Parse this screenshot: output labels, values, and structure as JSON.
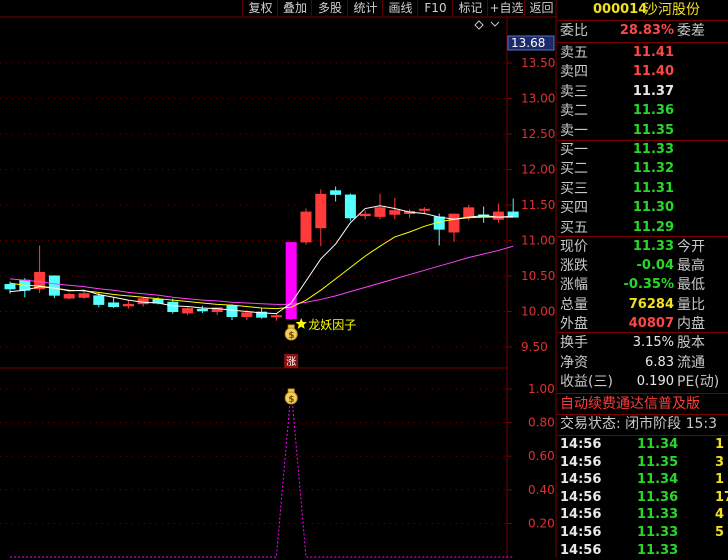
{
  "toolbar": [
    "复权",
    "叠加",
    "多股",
    "统计",
    "画线",
    "F10",
    "标记",
    "+自选",
    "返回"
  ],
  "stock": {
    "code": "000014",
    "name": "沙河股份"
  },
  "price_axis": {
    "current_tag": "13.68",
    "ticks": [
      "13.50",
      "13.00",
      "12.50",
      "12.00",
      "11.50",
      "11.00",
      "10.50",
      "10.00",
      "9.50"
    ]
  },
  "indicator_axis": {
    "ticks": [
      "1.00",
      "0.80",
      "0.60",
      "0.40",
      "0.20"
    ]
  },
  "annotations": {
    "signal": "龙妖因子",
    "limit_up": "涨"
  },
  "icons": {
    "money_bag": "money-bag-icon",
    "star": "star-icon",
    "diamond": "diamond-icon"
  },
  "colors": {
    "up": "#ff3c3c",
    "down": "#54ffff",
    "limit": "#ff00ff",
    "ma5": "#ffffff",
    "ma10": "#ffff00",
    "ma20": "#ff40ff",
    "grid": "#7a0000",
    "signal": "#ffff00"
  },
  "order_book": {
    "weibi": {
      "label": "委比",
      "value": "28.83%",
      "suffix": "委差"
    },
    "sells": [
      {
        "label": "卖五",
        "price": "11.41"
      },
      {
        "label": "卖四",
        "price": "11.40"
      },
      {
        "label": "卖三",
        "price": "11.37"
      },
      {
        "label": "卖二",
        "price": "11.36"
      },
      {
        "label": "卖一",
        "price": "11.35"
      }
    ],
    "buys": [
      {
        "label": "买一",
        "price": "11.33"
      },
      {
        "label": "买二",
        "price": "11.32"
      },
      {
        "label": "买三",
        "price": "11.31"
      },
      {
        "label": "买四",
        "price": "11.30"
      },
      {
        "label": "买五",
        "price": "11.29"
      }
    ]
  },
  "stats": [
    {
      "label": "现价",
      "value": "11.33",
      "label2": "今开"
    },
    {
      "label": "涨跌",
      "value": "-0.04",
      "label2": "最高"
    },
    {
      "label": "涨幅",
      "value": "-0.35%",
      "label2": "最低"
    },
    {
      "label": "总量",
      "value": "76284",
      "label2": "量比"
    },
    {
      "label": "外盘",
      "value": "40807",
      "label2": "内盘"
    }
  ],
  "stats2": [
    {
      "label": "换手",
      "value": "3.15%",
      "label2": "股本"
    },
    {
      "label": "净资",
      "value": "6.83",
      "label2": "流通"
    },
    {
      "label": "收益(三)",
      "value": "0.190",
      "label2": "PE(动)"
    }
  ],
  "promo": "自动续费通达信普及版",
  "trade_state": "交易状态: 闭市阶段 15:3",
  "ticks": [
    {
      "time": "14:56",
      "price": "11.34",
      "vol": "1"
    },
    {
      "time": "14:56",
      "price": "11.35",
      "vol": "3"
    },
    {
      "time": "14:56",
      "price": "11.34",
      "vol": "1"
    },
    {
      "time": "14:56",
      "price": "11.36",
      "vol": "17"
    },
    {
      "time": "14:56",
      "price": "11.33",
      "vol": "4"
    },
    {
      "time": "14:56",
      "price": "11.33",
      "vol": "5"
    },
    {
      "time": "14:56",
      "price": "11.33",
      "vol": ""
    }
  ],
  "chart_data": [
    {
      "type": "candlestick",
      "ylim": [
        9.3,
        13.68
      ],
      "candles": [
        {
          "o": 10.38,
          "h": 10.42,
          "l": 10.25,
          "c": 10.32
        },
        {
          "o": 10.44,
          "h": 10.47,
          "l": 10.2,
          "c": 10.3
        },
        {
          "o": 10.32,
          "h": 10.93,
          "l": 10.26,
          "c": 10.55
        },
        {
          "o": 10.5,
          "h": 10.51,
          "l": 10.19,
          "c": 10.23
        },
        {
          "o": 10.19,
          "h": 10.26,
          "l": 10.17,
          "c": 10.24
        },
        {
          "o": 10.2,
          "h": 10.3,
          "l": 10.18,
          "c": 10.25
        },
        {
          "o": 10.22,
          "h": 10.26,
          "l": 10.06,
          "c": 10.1
        },
        {
          "o": 10.12,
          "h": 10.2,
          "l": 10.05,
          "c": 10.07
        },
        {
          "o": 10.08,
          "h": 10.16,
          "l": 10.04,
          "c": 10.1
        },
        {
          "o": 10.11,
          "h": 10.2,
          "l": 10.07,
          "c": 10.18
        },
        {
          "o": 10.17,
          "h": 10.2,
          "l": 10.1,
          "c": 10.12
        },
        {
          "o": 10.13,
          "h": 10.18,
          "l": 9.97,
          "c": 10.0
        },
        {
          "o": 9.98,
          "h": 10.06,
          "l": 9.95,
          "c": 10.04
        },
        {
          "o": 10.03,
          "h": 10.08,
          "l": 9.98,
          "c": 10.01
        },
        {
          "o": 10.0,
          "h": 10.06,
          "l": 9.95,
          "c": 10.05
        },
        {
          "o": 10.08,
          "h": 10.1,
          "l": 9.88,
          "c": 9.93
        },
        {
          "o": 9.93,
          "h": 10.02,
          "l": 9.88,
          "c": 9.98
        },
        {
          "o": 9.99,
          "h": 10.05,
          "l": 9.9,
          "c": 9.92
        },
        {
          "o": 9.93,
          "h": 9.97,
          "l": 9.87,
          "c": 9.94
        },
        {
          "o": 9.9,
          "h": 10.97,
          "l": 9.88,
          "c": 10.97
        },
        {
          "o": 10.98,
          "h": 11.45,
          "l": 10.94,
          "c": 11.4
        },
        {
          "o": 11.18,
          "h": 11.72,
          "l": 10.92,
          "c": 11.65
        },
        {
          "o": 11.7,
          "h": 11.76,
          "l": 11.55,
          "c": 11.65
        },
        {
          "o": 11.64,
          "h": 11.66,
          "l": 11.28,
          "c": 11.32
        },
        {
          "o": 11.35,
          "h": 11.42,
          "l": 11.3,
          "c": 11.37
        },
        {
          "o": 11.34,
          "h": 11.66,
          "l": 11.3,
          "c": 11.46
        },
        {
          "o": 11.37,
          "h": 11.6,
          "l": 11.3,
          "c": 11.42
        },
        {
          "o": 11.38,
          "h": 11.44,
          "l": 11.32,
          "c": 11.41
        },
        {
          "o": 11.43,
          "h": 11.47,
          "l": 11.37,
          "c": 11.44
        },
        {
          "o": 11.33,
          "h": 11.38,
          "l": 10.93,
          "c": 11.16
        },
        {
          "o": 11.12,
          "h": 11.38,
          "l": 10.98,
          "c": 11.37
        },
        {
          "o": 11.33,
          "h": 11.5,
          "l": 11.28,
          "c": 11.46
        },
        {
          "o": 11.36,
          "h": 11.48,
          "l": 11.25,
          "c": 11.33
        },
        {
          "o": 11.3,
          "h": 11.52,
          "l": 11.25,
          "c": 11.4
        },
        {
          "o": 11.4,
          "h": 11.59,
          "l": 11.33,
          "c": 11.33
        }
      ],
      "ma5": [
        10.28,
        10.3,
        10.35,
        10.33,
        10.29,
        10.3,
        10.24,
        10.2,
        10.16,
        10.13,
        10.12,
        10.08,
        10.07,
        10.05,
        10.04,
        10.02,
        10.0,
        9.98,
        9.97,
        10.12,
        10.43,
        10.74,
        10.95,
        11.25,
        11.45,
        11.49,
        11.45,
        11.4,
        11.38,
        11.33,
        11.3,
        11.33,
        11.35,
        11.33,
        11.34
      ],
      "ma10": [
        10.4,
        10.37,
        10.36,
        10.33,
        10.3,
        10.29,
        10.27,
        10.24,
        10.22,
        10.2,
        10.18,
        10.16,
        10.14,
        10.12,
        10.1,
        10.09,
        10.07,
        10.05,
        10.04,
        10.06,
        10.16,
        10.3,
        10.46,
        10.62,
        10.78,
        10.92,
        11.05,
        11.12,
        11.2,
        11.26,
        11.3,
        11.32,
        11.33,
        11.33,
        11.33
      ],
      "ma20": [
        10.46,
        10.44,
        10.42,
        10.39,
        10.37,
        10.35,
        10.32,
        10.3,
        10.27,
        10.25,
        10.23,
        10.2,
        10.18,
        10.16,
        10.15,
        10.13,
        10.12,
        10.11,
        10.1,
        10.1,
        10.13,
        10.17,
        10.22,
        10.28,
        10.34,
        10.4,
        10.46,
        10.52,
        10.58,
        10.64,
        10.7,
        10.76,
        10.81,
        10.86,
        10.92
      ]
    },
    {
      "type": "line",
      "ylim": [
        0,
        1.1
      ],
      "values": [
        0,
        0,
        0,
        0,
        0,
        0,
        0,
        0,
        0,
        0,
        0,
        0,
        0,
        0,
        0,
        0,
        0,
        0,
        0,
        1,
        0,
        0,
        0,
        0,
        0,
        0,
        0,
        0,
        0,
        0,
        0,
        0,
        0,
        0,
        0
      ]
    }
  ]
}
